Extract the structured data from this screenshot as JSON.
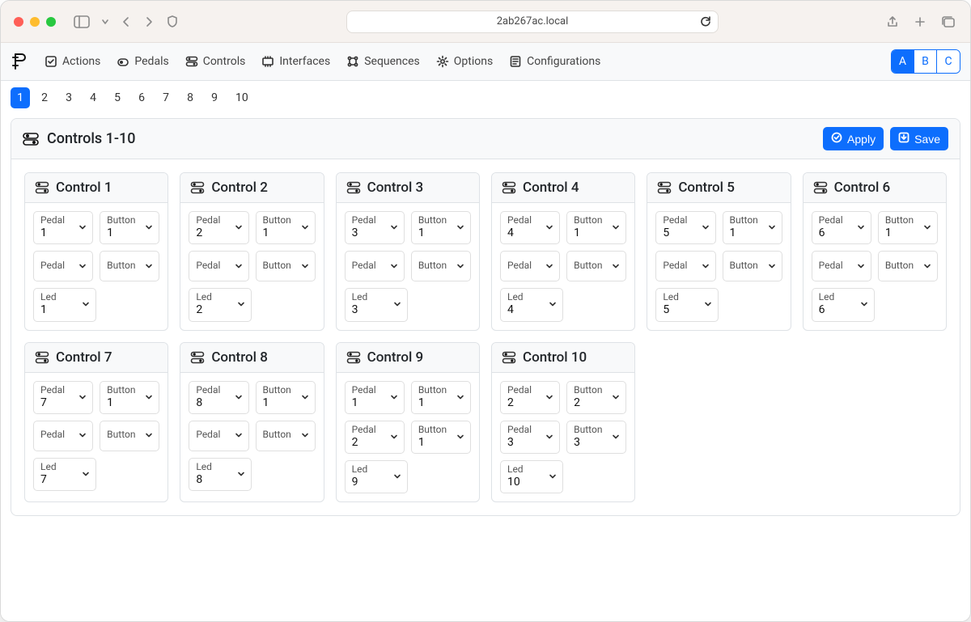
{
  "browser": {
    "address": "2ab267ac.local"
  },
  "nav": {
    "items": [
      {
        "key": "actions",
        "label": "Actions"
      },
      {
        "key": "pedals",
        "label": "Pedals"
      },
      {
        "key": "controls",
        "label": "Controls"
      },
      {
        "key": "interfaces",
        "label": "Interfaces"
      },
      {
        "key": "sequences",
        "label": "Sequences"
      },
      {
        "key": "options",
        "label": "Options"
      },
      {
        "key": "configurations",
        "label": "Configurations"
      }
    ],
    "abc": {
      "options": [
        "A",
        "B",
        "C"
      ],
      "active": "A"
    }
  },
  "pagination": {
    "pages": [
      "1",
      "2",
      "3",
      "4",
      "5",
      "6",
      "7",
      "8",
      "9",
      "10"
    ],
    "active": "1"
  },
  "panel": {
    "title": "Controls 1-10",
    "apply_label": "Apply",
    "save_label": "Save"
  },
  "field_labels": {
    "pedal": "Pedal",
    "button": "Button",
    "led": "Led"
  },
  "controls": [
    {
      "title": "Control 1",
      "pedal1": "1",
      "button1": "1",
      "pedal2": "",
      "button2": "",
      "led": "1"
    },
    {
      "title": "Control 2",
      "pedal1": "2",
      "button1": "1",
      "pedal2": "",
      "button2": "",
      "led": "2"
    },
    {
      "title": "Control 3",
      "pedal1": "3",
      "button1": "1",
      "pedal2": "",
      "button2": "",
      "led": "3"
    },
    {
      "title": "Control 4",
      "pedal1": "4",
      "button1": "1",
      "pedal2": "",
      "button2": "",
      "led": "4"
    },
    {
      "title": "Control 5",
      "pedal1": "5",
      "button1": "1",
      "pedal2": "",
      "button2": "",
      "led": "5"
    },
    {
      "title": "Control 6",
      "pedal1": "6",
      "button1": "1",
      "pedal2": "",
      "button2": "",
      "led": "6"
    },
    {
      "title": "Control 7",
      "pedal1": "7",
      "button1": "1",
      "pedal2": "",
      "button2": "",
      "led": "7"
    },
    {
      "title": "Control 8",
      "pedal1": "8",
      "button1": "1",
      "pedal2": "",
      "button2": "",
      "led": "8"
    },
    {
      "title": "Control 9",
      "pedal1": "1",
      "button1": "1",
      "pedal2": "2",
      "button2": "1",
      "led": "9"
    },
    {
      "title": "Control 10",
      "pedal1": "2",
      "button1": "2",
      "pedal2": "3",
      "button2": "3",
      "led": "10"
    }
  ]
}
